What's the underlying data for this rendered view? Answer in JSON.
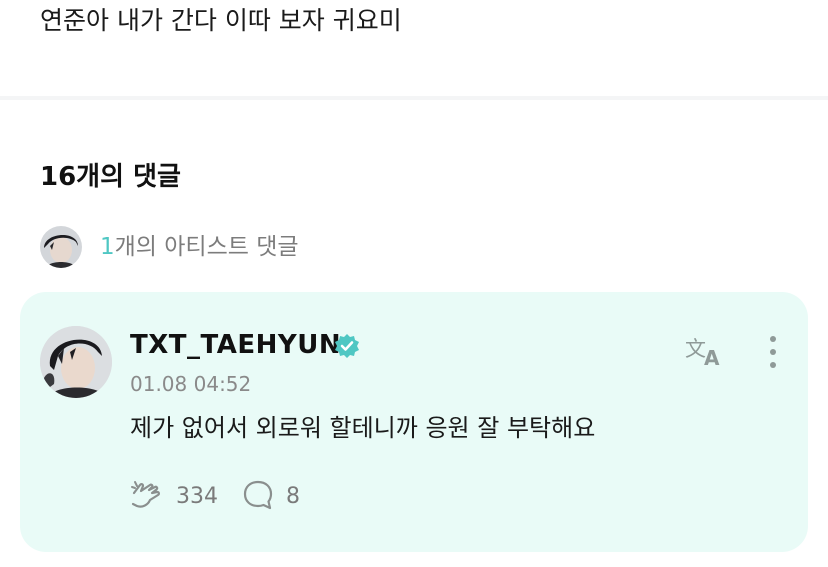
{
  "post": {
    "text": "연준아 내가 간다 이따 보자 귀요미"
  },
  "comments_header": {
    "title": "16개의 댓글"
  },
  "artist_comments": {
    "count": "1",
    "label": "개의 아티스트 댓글"
  },
  "comment": {
    "author": "TXT_TAEHYUN",
    "timestamp": "01.08 04:52",
    "text": "제가 없어서 외로워 할테니까 응원 잘 부탁해요",
    "like_count": "334",
    "reply_count": "8",
    "icons": {
      "verified": "verified-badge-icon",
      "translate": "translate-icon",
      "more": "more-vertical-icon",
      "like": "cheer-hands-icon",
      "reply": "speech-bubble-icon"
    }
  },
  "colors": {
    "accent": "#4fc7c3",
    "card_background": "#e9fbf7",
    "muted_text": "#8a8a8a"
  }
}
